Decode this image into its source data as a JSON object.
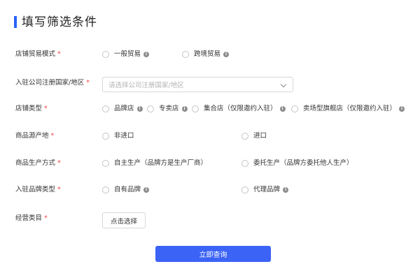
{
  "page": {
    "title": "填写筛选条件",
    "required_mark": "*"
  },
  "trade_mode": {
    "label": "店铺贸易模式",
    "options": [
      {
        "label": "一般贸易",
        "has_info": true
      },
      {
        "label": "跨境贸易",
        "has_info": true
      }
    ]
  },
  "country": {
    "label": "入驻公司注册国家/地区",
    "placeholder": "请选择公司注册国家/地区"
  },
  "shop_type": {
    "label": "店铺类型",
    "options": [
      {
        "label": "品牌店",
        "has_info": true
      },
      {
        "label": "专卖店",
        "has_info": true
      },
      {
        "label": "集合店（仅限邀约入驻）",
        "has_info": true
      },
      {
        "label": "卖场型旗舰店（仅限邀约入驻）",
        "has_info": true
      }
    ]
  },
  "origin": {
    "label": "商品源产地",
    "options": [
      {
        "label": "非进口",
        "has_info": false
      },
      {
        "label": "进口",
        "has_info": false
      }
    ]
  },
  "production": {
    "label": "商品生产方式",
    "options": [
      {
        "label": "自主生产（品牌方是生产厂商）",
        "has_info": false
      },
      {
        "label": "委托生产（品牌方委托他人生产）",
        "has_info": false
      }
    ]
  },
  "brand_type": {
    "label": "入驻品牌类型",
    "options": [
      {
        "label": "自有品牌",
        "has_info": true
      },
      {
        "label": "代理品牌",
        "has_info": true
      }
    ]
  },
  "category": {
    "label": "经营类目",
    "button_label": "点击选择"
  },
  "submit": {
    "label": "立即查询"
  },
  "colors": {
    "accent": "#3b63f6",
    "required": "#f04848"
  }
}
